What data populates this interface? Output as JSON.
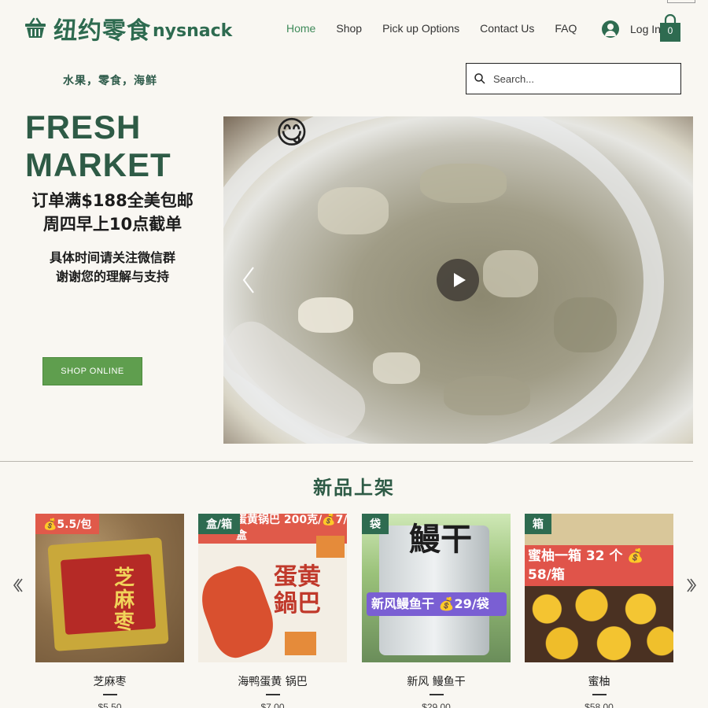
{
  "brand": {
    "name_cn": "纽约零食",
    "name_en": "nysnack",
    "tagline": "水果，零食，海鲜"
  },
  "nav": {
    "items": [
      {
        "label": "Home",
        "active": true
      },
      {
        "label": "Shop",
        "active": false
      },
      {
        "label": "Pick up Options",
        "active": false
      },
      {
        "label": "Contact Us",
        "active": false
      },
      {
        "label": "FAQ",
        "active": false
      }
    ],
    "login_label": "Log In",
    "cart_count": "0"
  },
  "search": {
    "placeholder": "Search..."
  },
  "hero": {
    "title_line1": "FRESH",
    "title_line2": "MARKET",
    "promo_line1": "订单满$188全美包邮",
    "promo_line2": "周四早上10点截单",
    "note_line1": "具体时间请关注微信群",
    "note_line2": "谢谢您的理解与支持",
    "cta_label": "SHOP ONLINE",
    "emoji": "😋"
  },
  "new_arrivals": {
    "title": "新品上架",
    "products": [
      {
        "name": "芝麻枣",
        "price": "$5.50",
        "badge": "💰5.5/包",
        "overlay": ""
      },
      {
        "name": "海鸭蛋黄 锅巴",
        "price": "$7.00",
        "badge": "盒/箱",
        "overlay": "蛋黄锅巴 200克/💰7/盒"
      },
      {
        "name": "新风 鳗鱼干",
        "price": "$29.00",
        "badge": "袋",
        "overlay": "新风鳗鱼干 💰29/袋"
      },
      {
        "name": "蜜柚",
        "price": "$58.00",
        "badge": "箱",
        "overlay": "蜜柚一箱 32 个 💰 58/箱"
      }
    ]
  },
  "colors": {
    "brand_green": "#2e6b50",
    "cta_green": "#5f9e4e",
    "background": "#f9f7f2"
  }
}
